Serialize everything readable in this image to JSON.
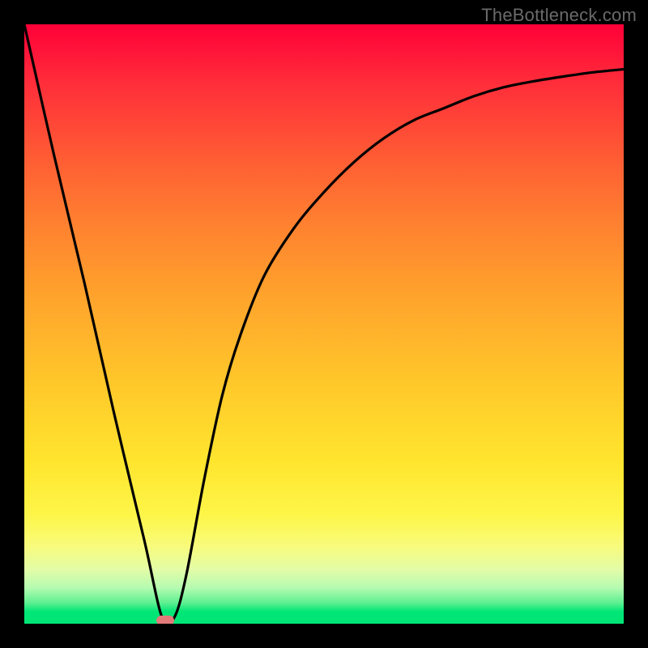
{
  "attribution": "TheBottleneck.com",
  "chart_data": {
    "type": "line",
    "title": "",
    "xlabel": "",
    "ylabel": "",
    "xlim": [
      0,
      100
    ],
    "ylim": [
      0,
      100
    ],
    "x": [
      0,
      5,
      10,
      15,
      20,
      23,
      25,
      27,
      30,
      33,
      36,
      40,
      45,
      50,
      55,
      60,
      65,
      70,
      75,
      80,
      85,
      90,
      95,
      100
    ],
    "y": [
      100,
      78,
      57,
      35,
      14,
      1,
      1,
      8,
      24,
      38,
      48,
      58,
      66,
      72,
      77,
      81,
      84,
      86,
      88,
      89.5,
      90.5,
      91.3,
      92,
      92.5
    ],
    "marker": {
      "x": 23.5,
      "y": 0.5
    },
    "gradient_stops": [
      {
        "pos": 0,
        "color": "#ff0038"
      },
      {
        "pos": 0.5,
        "color": "#ffb02c"
      },
      {
        "pos": 0.8,
        "color": "#fff23a"
      },
      {
        "pos": 1.0,
        "color": "#00e676"
      }
    ]
  }
}
